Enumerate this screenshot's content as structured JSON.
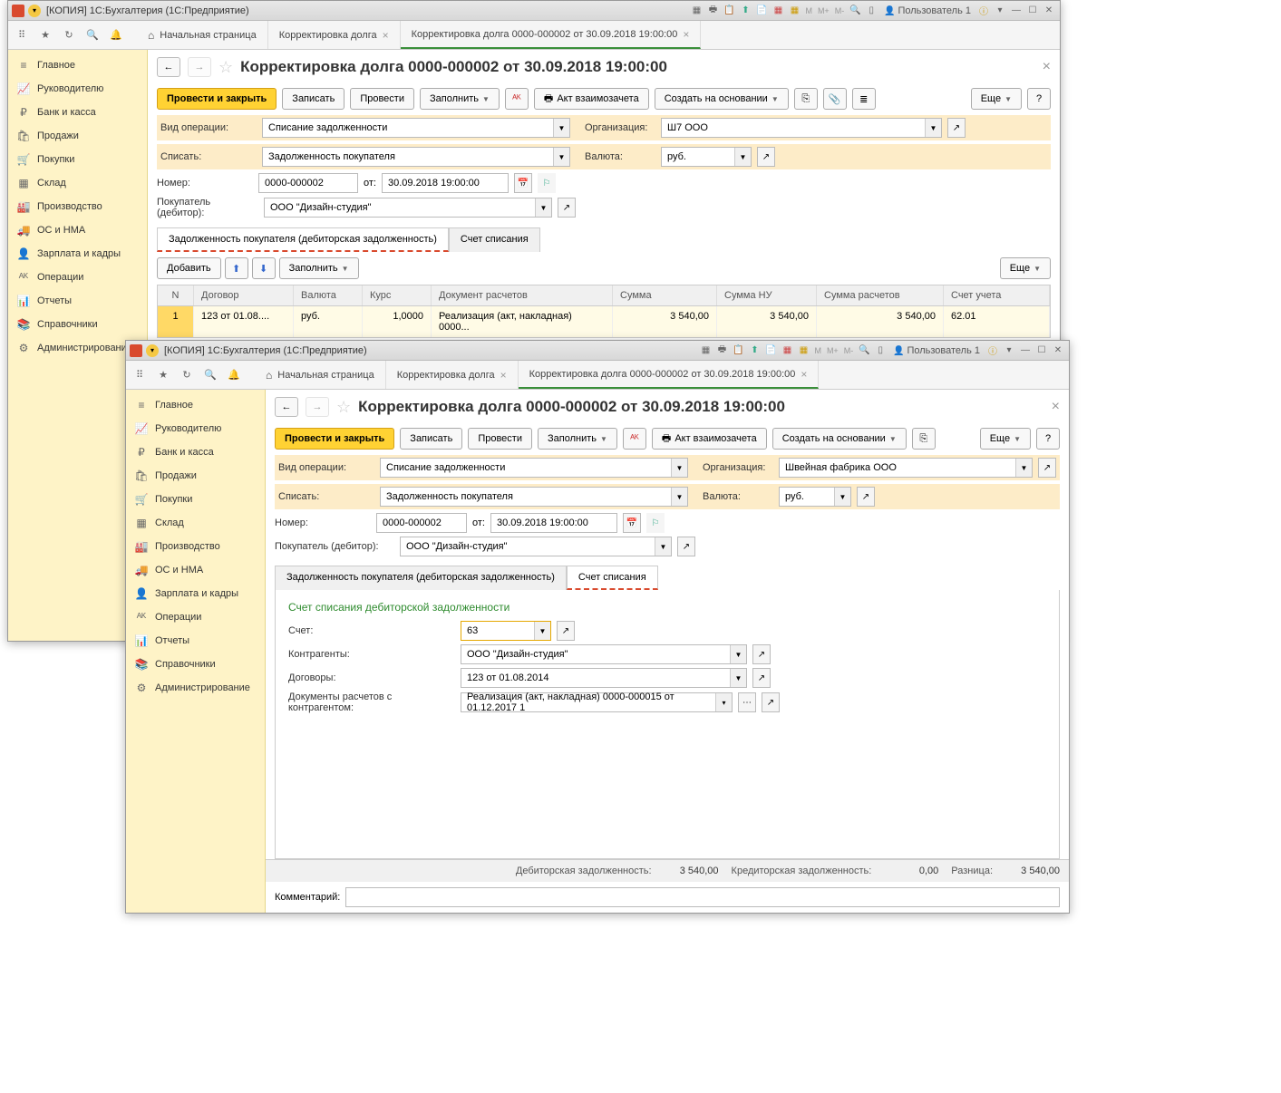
{
  "app_title": "[КОПИЯ] 1С:Бухгалтерия  (1С:Предприятие)",
  "user_label": "Пользователь 1",
  "m_indicators": [
    "M",
    "M+",
    "M-"
  ],
  "toolbar_tabs": {
    "home": "Начальная страница",
    "t1": "Корректировка долга",
    "t2": "Корректировка долга 0000-000002 от 30.09.2018 19:00:00"
  },
  "sidebar": [
    {
      "icon": "≡",
      "label": "Главное"
    },
    {
      "icon": "📈",
      "label": "Руководителю"
    },
    {
      "icon": "₽",
      "label": "Банк и касса"
    },
    {
      "icon": "🛍",
      "label": "Продажи"
    },
    {
      "icon": "🛒",
      "label": "Покупки"
    },
    {
      "icon": "▦",
      "label": "Склад"
    },
    {
      "icon": "🏭",
      "label": "Производство"
    },
    {
      "icon": "🚚",
      "label": "ОС и НМА"
    },
    {
      "icon": "👤",
      "label": "Зарплата и кадры"
    },
    {
      "icon": "ᴬᴷ",
      "label": "Операции"
    },
    {
      "icon": "📊",
      "label": "Отчеты"
    },
    {
      "icon": "📚",
      "label": "Справочники"
    },
    {
      "icon": "⚙",
      "label": "Администрирование"
    }
  ],
  "page_title": "Корректировка долга 0000-000002 от 30.09.2018 19:00:00",
  "buttons": {
    "post_close": "Провести и закрыть",
    "write": "Записать",
    "post": "Провести",
    "fill": "Заполнить",
    "offset": "Акт взаимозачета",
    "create_based": "Создать на основании",
    "more": "Еще",
    "help": "?",
    "add": "Добавить"
  },
  "labels": {
    "op_type": "Вид операции:",
    "write_off": "Списать:",
    "number": "Номер:",
    "from": "от:",
    "buyer": "Покупатель (дебитор):",
    "org": "Организация:",
    "currency": "Валюта:",
    "account": "Счет:",
    "counterparty": "Контрагенты:",
    "contracts": "Договоры:",
    "settle_docs": "Документы расчетов с контрагентом:",
    "comment": "Комментарий:"
  },
  "win1": {
    "op_type_val": "Списание задолженности",
    "write_off_val": "Задолженность покупателя",
    "number_val": "0000-000002",
    "date_val": "30.09.2018 19:00:00",
    "buyer_val": "ООО \"Дизайн-студия\"",
    "org_val": "Ш7 ООО",
    "currency_val": "руб.",
    "tabs": {
      "t1": "Задолженность покупателя (дебиторская задолженность)",
      "t2": "Счет списания"
    },
    "grid_head": [
      "N",
      "Договор",
      "Валюта",
      "Курс",
      "Документ расчетов",
      "Сумма",
      "Сумма НУ",
      "Сумма расчетов",
      "Счет учета"
    ],
    "grid_row": {
      "n": "1",
      "contract": "123 от 01.08....",
      "curr": "руб.",
      "rate": "1,0000",
      "doc": "Реализация (акт, накладная) 0000...",
      "sum": "3 540,00",
      "sum_nu": "3 540,00",
      "sum_calc": "3 540,00",
      "acc": "62.01"
    }
  },
  "win2": {
    "op_type_val": "Списание задолженности",
    "write_off_val": "Задолженность покупателя",
    "number_val": "0000-000002",
    "date_val": "30.09.2018 19:00:00",
    "buyer_val": "ООО \"Дизайн-студия\"",
    "org_val": "Швейная фабрика ООО",
    "currency_val": "руб.",
    "tabs": {
      "t1": "Задолженность покупателя (дебиторская задолженность)",
      "t2": "Счет списания"
    },
    "section_title": "Счет списания дебиторской задолженности",
    "account_val": "63",
    "counterparty_val": "ООО \"Дизайн-студия\"",
    "contract_val": "123 от 01.08.2014",
    "settle_doc_val": "Реализация (акт, накладная) 0000-000015 от 01.12.2017 1",
    "footer": {
      "debit_label": "Дебиторская задолженность:",
      "debit_val": "3 540,00",
      "credit_label": "Кредиторская задолженность:",
      "credit_val": "0,00",
      "diff_label": "Разница:",
      "diff_val": "3 540,00"
    }
  }
}
